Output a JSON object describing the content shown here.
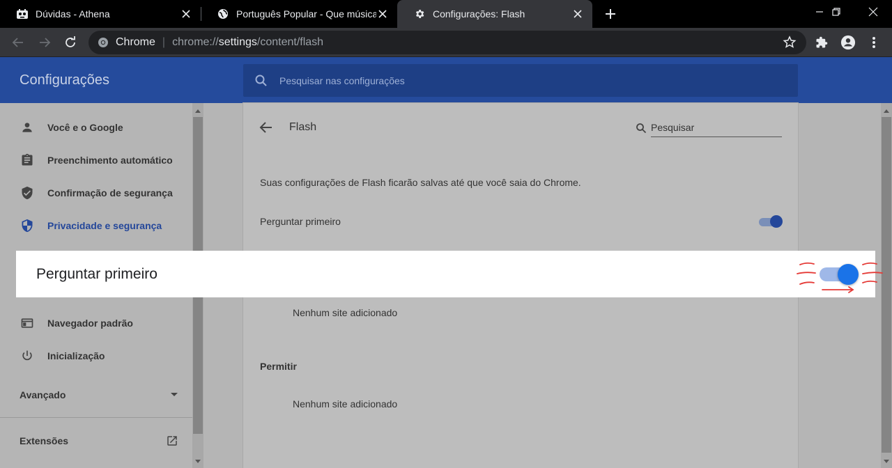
{
  "browser": {
    "tabs": [
      {
        "title": "Dúvidas - Athena",
        "favicon": "athena-logo-icon",
        "active": false
      },
      {
        "title": "Português Popular - Que música",
        "favicon": "globe-icon",
        "active": false
      },
      {
        "title": "Configurações: Flash",
        "favicon": "gear-icon",
        "active": true
      }
    ],
    "omnibox": {
      "site_label": "Chrome",
      "separator": "|",
      "url_scheme": "chrome://",
      "url_host": "settings",
      "url_path": "/content/flash"
    }
  },
  "settings": {
    "title": "Configurações",
    "search_placeholder": "Pesquisar nas configurações",
    "sidebar": {
      "items": [
        {
          "label": "Você e o Google",
          "icon": "person-icon",
          "active": false
        },
        {
          "label": "Preenchimento automático",
          "icon": "clipboard-icon",
          "active": false
        },
        {
          "label": "Confirmação de segurança",
          "icon": "shield-check-icon",
          "active": false
        },
        {
          "label": "Privacidade e segurança",
          "icon": "shield-icon",
          "active": true
        },
        {
          "label": "Navegador padrão",
          "icon": "browser-window-icon",
          "active": false
        },
        {
          "label": "Inicialização",
          "icon": "power-icon",
          "active": false
        }
      ],
      "advanced_label": "Avançado",
      "extensions_label": "Extensões"
    },
    "flash_page": {
      "title": "Flash",
      "search_placeholder": "Pesquisar",
      "note": "Suas configurações de Flash ficarão salvas até que você saia do Chrome.",
      "ask_first_label": "Perguntar primeiro",
      "ask_first_enabled": true,
      "block_empty": "Nenhum site adicionado",
      "allow_label": "Permitir",
      "allow_empty": "Nenhum site adicionado"
    }
  },
  "callout": {
    "label": "Perguntar primeiro",
    "toggle_on": true
  },
  "colors": {
    "accent": "#1a73e8",
    "header_blue": "#254b9c",
    "emphasis_red": "#e53935"
  }
}
